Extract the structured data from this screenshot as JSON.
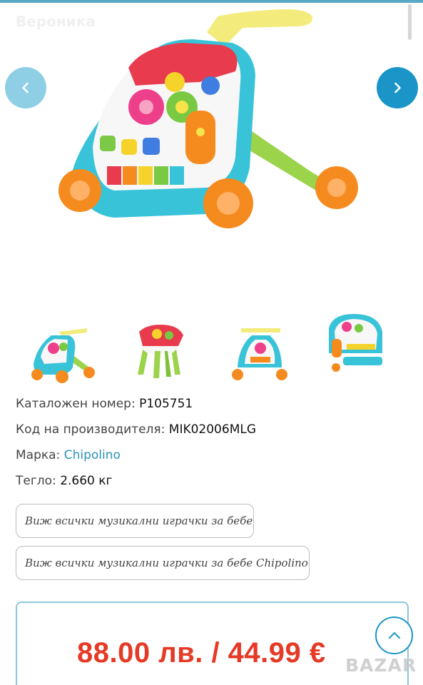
{
  "seller": {
    "name": "Вероника"
  },
  "gallery": {
    "prev_icon": "chevron-left-icon",
    "next_icon": "chevron-right-icon"
  },
  "details": {
    "catalog_label": "Каталожен номер:",
    "catalog_value": "P105751",
    "manufacturer_code_label": "Код на производителя:",
    "manufacturer_code_value": "MIK02006MLG",
    "brand_label": "Марка:",
    "brand_value": "Chipolino",
    "weight_label": "Тегло:",
    "weight_value": "2.660 кг"
  },
  "tags": {
    "all_musical": "Виж всички музикални играчки за бебе",
    "all_musical_brand": "Виж всички музикални играчки за бебе Chipolino"
  },
  "price": {
    "text": "88.00 лв. / 44.99 €"
  },
  "watermark": {
    "text": "BAZAR"
  },
  "colors": {
    "accent": "#1b95c8",
    "price": "#e53a26",
    "link": "#2a92bd"
  }
}
